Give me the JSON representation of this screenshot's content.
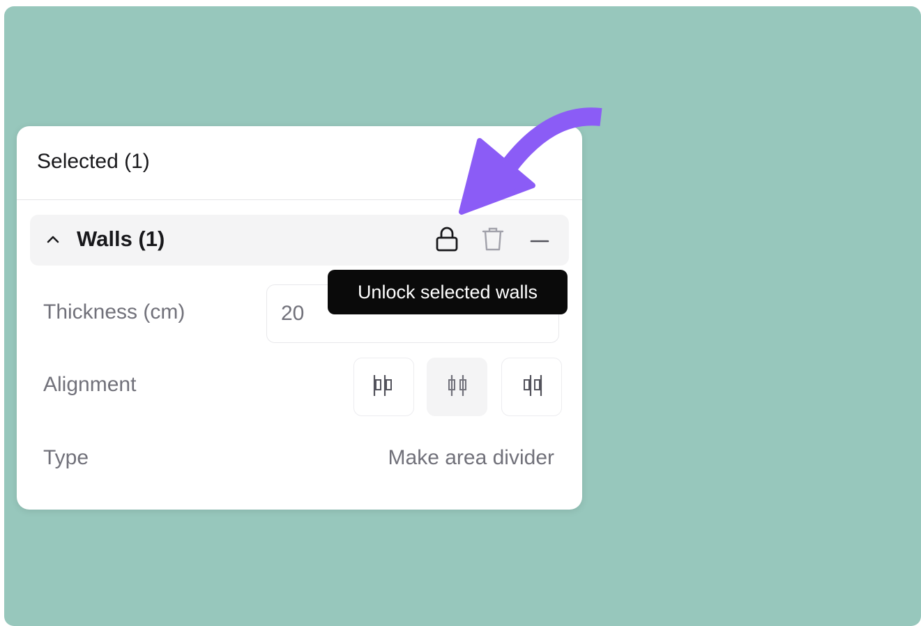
{
  "panel": {
    "title": "Selected (1)"
  },
  "section": {
    "title": "Walls (1)",
    "icons": {
      "collapse": "chevron-up-icon",
      "lock": "lock-icon",
      "delete": "trash-icon",
      "remove": "minus-icon"
    }
  },
  "fields": {
    "thickness_label": "Thickness (cm)",
    "thickness_value": "20",
    "alignment_label": "Alignment",
    "alignment_options": [
      "align-left-icon",
      "align-center-icon",
      "align-right-icon"
    ],
    "alignment_selected": "center",
    "type_label": "Type",
    "type_action": "Make area divider"
  },
  "tooltip": {
    "text": "Unlock selected walls"
  },
  "colors": {
    "background": "#97c7bc",
    "arrow": "#8b5cf6",
    "tooltip_bg": "#0a0a0a"
  }
}
